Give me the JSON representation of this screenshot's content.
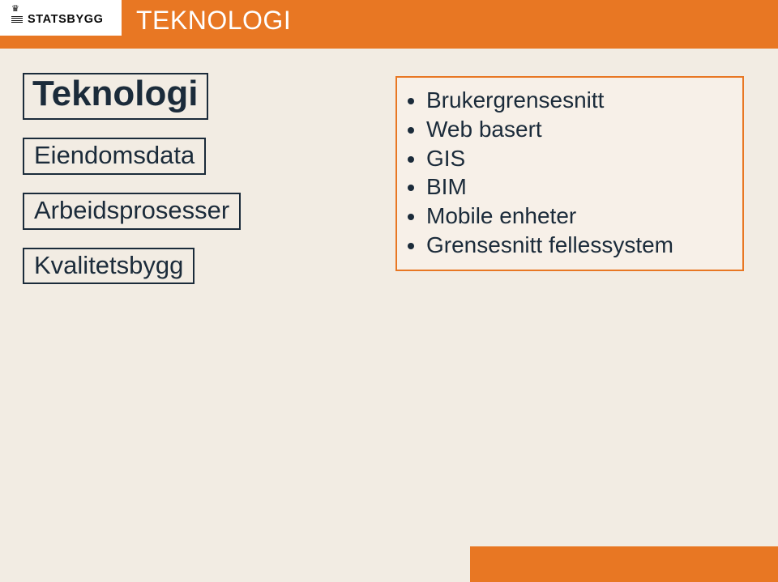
{
  "brand": {
    "name": "STATSBYGG",
    "crown_glyph": "♛"
  },
  "slide": {
    "title": "TEKNOLOGI"
  },
  "left_boxes": [
    {
      "text": "Teknologi",
      "style": "large"
    },
    {
      "text": "Eiendomsdata",
      "style": "normal"
    },
    {
      "text": "Arbeidsprosesser",
      "style": "normal"
    },
    {
      "text": "Kvalitetsbygg",
      "style": "normal"
    }
  ],
  "details": {
    "items": [
      "Brukergrensesnitt",
      "Web basert",
      "GIS",
      "BIM",
      "Mobile enheter",
      "Grensesnitt fellessystem"
    ]
  },
  "colors": {
    "background": "#F2ECE3",
    "accent": "#E87723",
    "text": "#1b2b3a",
    "panel_bg": "#F7F0E8"
  }
}
